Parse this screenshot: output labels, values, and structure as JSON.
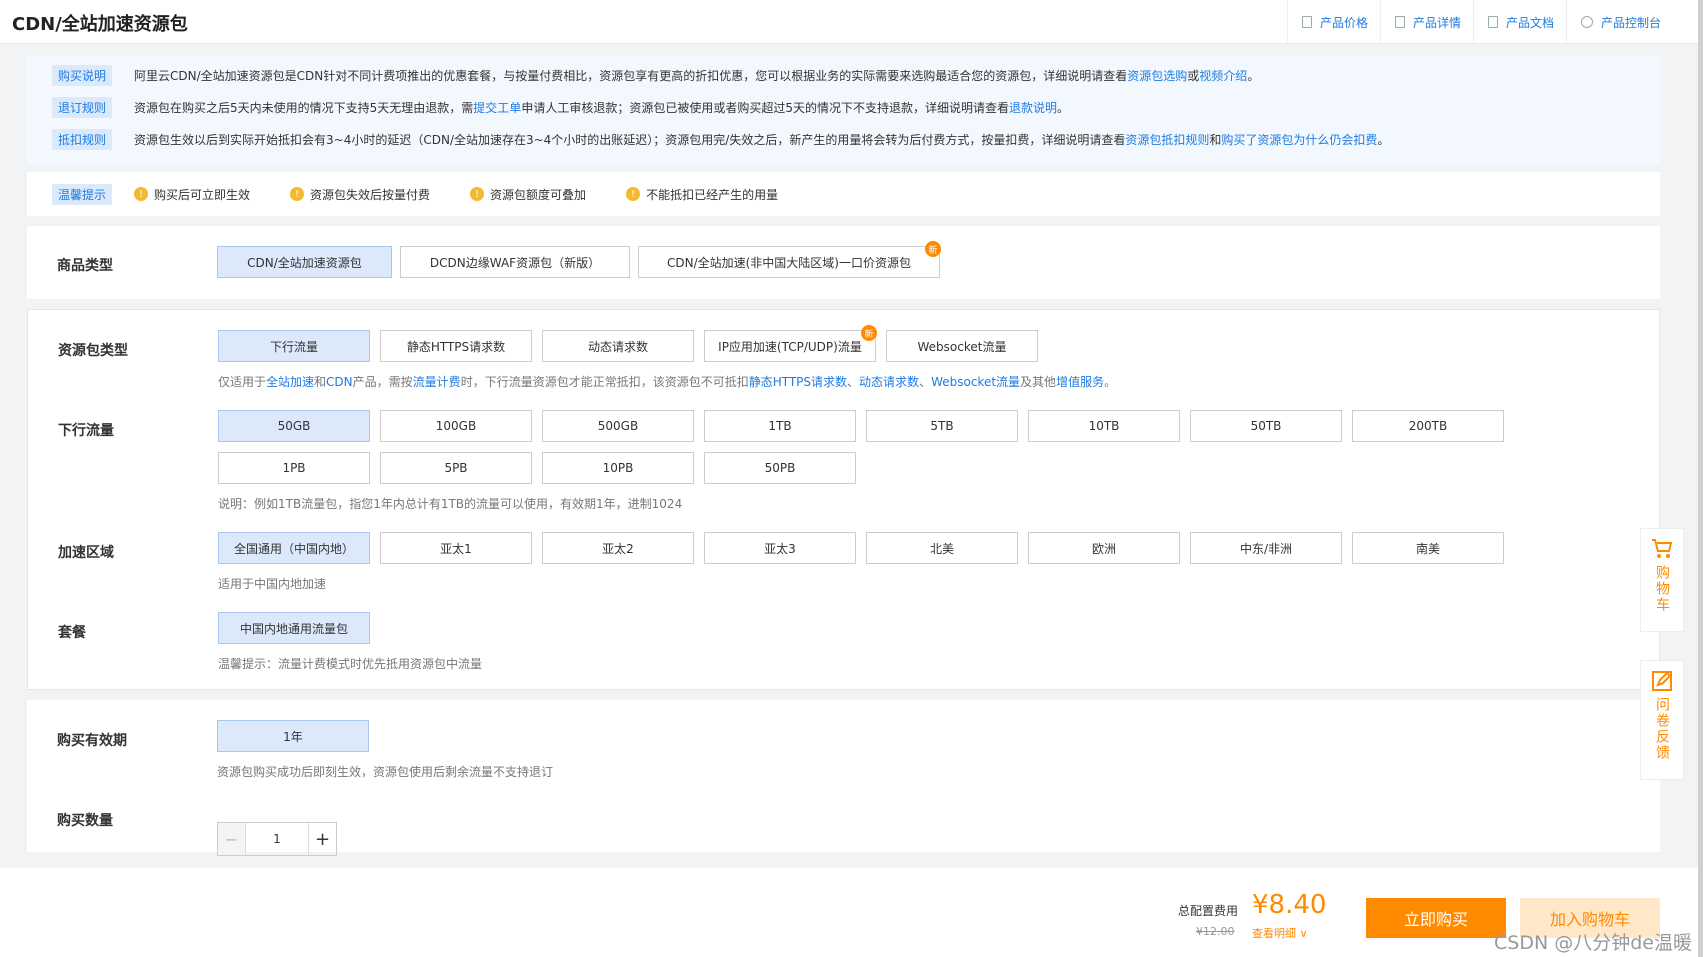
{
  "header": {
    "title": "CDN/全站加速资源包",
    "links": [
      "产品价格",
      "产品详情",
      "产品文档",
      "产品控制台"
    ]
  },
  "notice": {
    "purchase_tag": "购买说明",
    "purchase_text_1": "阿里云CDN/全站加速资源包是CDN针对不同计费项推出的优惠套餐，与按量付费相比，资源包享有更高的折扣优惠，您可以根据业务的实际需要来选购最适合您的资源包，详细说明请查看",
    "purchase_link_1": "资源包选购",
    "purchase_or": "或",
    "purchase_link_2": "视频介绍",
    "purchase_end": "。",
    "refund_tag": "退订规则",
    "refund_text_1": "资源包在购买之后5天内未使用的情况下支持5天无理由退款，需",
    "refund_link_1": "提交工单",
    "refund_text_2": "申请人工审核退款；资源包已被使用或者购买超过5天的情况下不支持退款，详细说明请查看",
    "refund_link_2": "退款说明",
    "refund_end": "。",
    "deduct_tag": "抵扣规则",
    "deduct_text_1": "资源包生效以后到实际开始抵扣会有3~4小时的延迟（CDN/全站加速存在3~4个小时的出账延迟）；资源包用完/失效之后，新产生的用量将会转为后付费方式，按量扣费，详细说明请查看",
    "deduct_link_1": "资源包抵扣规则",
    "deduct_and": "和",
    "deduct_link_2": "购买了资源包为什么仍会扣费",
    "deduct_end": "。"
  },
  "tips": {
    "tag": "温馨提示",
    "items": [
      "购买后可立即生效",
      "资源包失效后按量付费",
      "资源包额度可叠加",
      "不能抵扣已经产生的用量"
    ]
  },
  "product_type": {
    "label": "商品类型",
    "options": [
      "CDN/全站加速资源包",
      "DCDN边缘WAF资源包（新版）",
      "CDN/全站加速(非中国大陆区域)一口价资源包"
    ],
    "new_badge": "新"
  },
  "package_type": {
    "label": "资源包类型",
    "options": [
      "下行流量",
      "静态HTTPS请求数",
      "动态请求数",
      "IP应用加速(TCP/UDP)流量",
      "Websocket流量"
    ],
    "hint_1": "仅适用于",
    "hint_link_1": "全站加速",
    "hint_2": "和",
    "hint_link_2": "CDN",
    "hint_3": "产品，需按",
    "hint_link_3": "流量计费",
    "hint_4": "时，下行流量资源包才能正常抵扣，该资源包不可抵扣",
    "hint_link_4": "静态HTTPS请求数",
    "hint_5": "、",
    "hint_link_5": "动态请求数",
    "hint_6": "、",
    "hint_link_6": "Websocket流量",
    "hint_7": "及其他",
    "hint_link_7": "增值服务",
    "hint_8": "。"
  },
  "traffic": {
    "label": "下行流量",
    "options": [
      "50GB",
      "100GB",
      "500GB",
      "1TB",
      "5TB",
      "10TB",
      "50TB",
      "200TB",
      "1PB",
      "5PB",
      "10PB",
      "50PB"
    ],
    "hint": "说明：例如1TB流量包，指您1年内总计有1TB的流量可以使用，有效期1年，进制1024"
  },
  "region": {
    "label": "加速区域",
    "options": [
      "全国通用（中国内地）",
      "亚太1",
      "亚太2",
      "亚太3",
      "北美",
      "欧洲",
      "中东/非洲",
      "南美"
    ],
    "hint": "适用于中国内地加速"
  },
  "plan": {
    "label": "套餐",
    "option": "中国内地通用流量包",
    "hint": "温馨提示：流量计费模式时优先抵用资源包中流量"
  },
  "validity": {
    "label": "购买有效期",
    "option": "1年",
    "hint": "资源包购买成功后即刻生效，资源包使用后剩余流量不支持退订"
  },
  "quantity": {
    "label": "购买数量",
    "value": "1",
    "minus": "−",
    "plus": "+"
  },
  "footer": {
    "total_label": "总配置费用",
    "price": "¥8.40",
    "old_price": "¥12.00",
    "detail": "查看明细 ∨",
    "buy": "立即购买",
    "add_cart": "加入购物车",
    "watermark": "CSDN @八分钟de温暖"
  },
  "floats": {
    "cart": "购物车",
    "survey": "问卷反馈"
  },
  "colors": {
    "accent": "#1f7be0",
    "orange": "#ff8a00",
    "selected_bg": "#dbe9fb"
  }
}
